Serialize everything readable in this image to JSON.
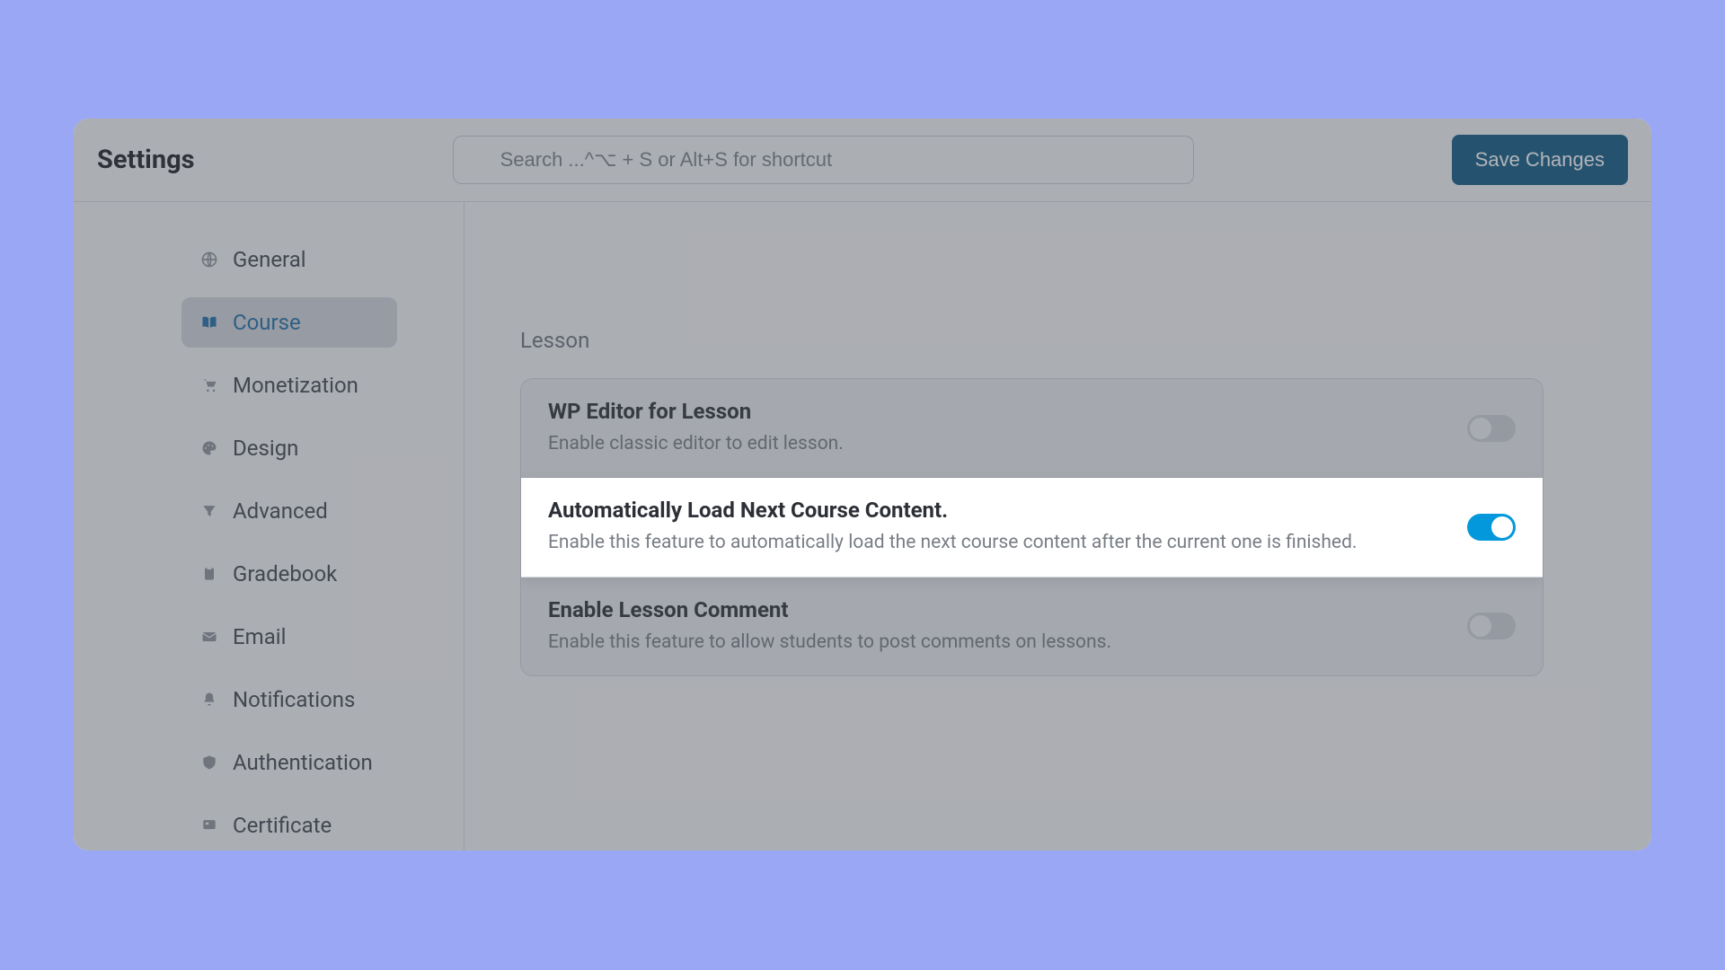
{
  "header": {
    "title": "Settings",
    "search_placeholder": "Search ...^⌥ + S or Alt+S for shortcut",
    "save_label": "Save Changes"
  },
  "sidebar": {
    "items": [
      {
        "label": "General",
        "icon": "globe-icon",
        "active": false
      },
      {
        "label": "Course",
        "icon": "book-icon",
        "active": true
      },
      {
        "label": "Monetization",
        "icon": "cart-icon",
        "active": false
      },
      {
        "label": "Design",
        "icon": "palette-icon",
        "active": false
      },
      {
        "label": "Advanced",
        "icon": "filter-icon",
        "active": false
      },
      {
        "label": "Gradebook",
        "icon": "clipboard-icon",
        "active": false
      },
      {
        "label": "Email",
        "icon": "mail-icon",
        "active": false
      },
      {
        "label": "Notifications",
        "icon": "bell-icon",
        "active": false
      },
      {
        "label": "Authentication",
        "icon": "shield-icon",
        "active": false
      },
      {
        "label": "Certificate",
        "icon": "badge-icon",
        "active": false
      }
    ]
  },
  "main": {
    "section_title": "Lesson",
    "settings": [
      {
        "title": "WP Editor for Lesson",
        "desc": "Enable classic editor to edit lesson.",
        "enabled": false,
        "highlight": false
      },
      {
        "title": "Automatically Load Next Course Content.",
        "desc": "Enable this feature to automatically load the next course content after the current one is finished.",
        "enabled": true,
        "highlight": true
      },
      {
        "title": "Enable Lesson Comment",
        "desc": "Enable this feature to allow students to post comments on lessons.",
        "enabled": false,
        "highlight": false
      }
    ]
  }
}
